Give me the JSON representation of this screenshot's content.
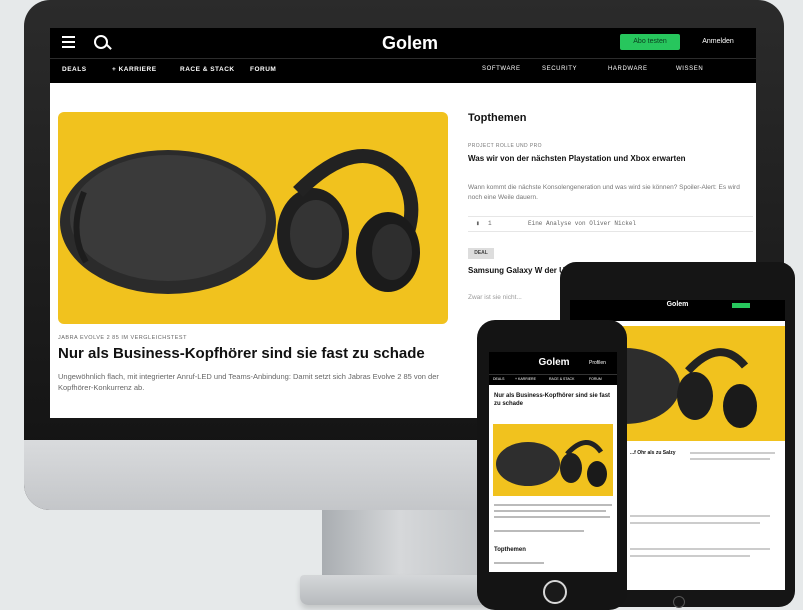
{
  "brand": {
    "accent_green": "#27c65d",
    "hero_yellow": "#f1c21e"
  },
  "desktop": {
    "logo": "Golem",
    "subscribe_button": "Abo testen",
    "login_link": "Anmelden",
    "nav_left": [
      "DEALS",
      "+ KARRIERE",
      "RACE & STACK",
      "FORUM"
    ],
    "nav_right": [
      "SOFTWARE",
      "SECURITY",
      "HARDWARE",
      "WISSEN"
    ],
    "hero": {
      "kicker": "JABRA EVOLVE 2 85 IM VERGLEICHSTEST",
      "headline": "Nur als Business-Kopfhörer sind sie fast zu schade",
      "teaser": "Ungewöhnlich flach, mit integrierter Anruf-LED und Teams-Anbindung: Damit setzt sich Jabras Evolve 2 85 von der Kopfhörer-Konkurrenz ab."
    },
    "topthemen": {
      "title": "Topthemen",
      "kicker": "PROJECT ROLLE UND PRO",
      "headline": "Was wir von der nächsten Playstation und Xbox erwarten",
      "teaser": "Wann kommt die nächste Konsolengeneration und was wird sie können? Spoiler-Alert: Es wird noch eine Weile dauern.",
      "comments": "1",
      "byline": "Eine Analyse von Oliver Nickel",
      "badge": "DEAL",
      "headline2": "Samsung Galaxy W der UVP",
      "teaser2": "Zwar ist sie nicht..."
    }
  },
  "tablet": {
    "logo": "Golem",
    "headline": "...f Ohr als zu Salzy"
  },
  "phone": {
    "logo": "Golem",
    "login": "Profilen",
    "nav": [
      "DEALS",
      "+ KARRIERE",
      "RACE & STACK",
      "FORUM"
    ],
    "headline": "Nur als Business-Kopfhörer sind sie fast zu schade",
    "section": "Topthemen"
  },
  "icons": [
    "menu-icon",
    "search-icon",
    "comment-icon"
  ]
}
